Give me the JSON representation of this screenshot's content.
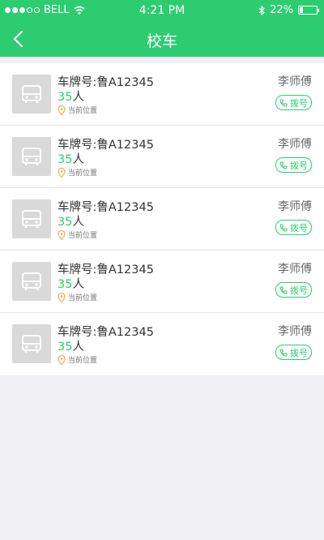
{
  "status_bar": {
    "carrier": "BELL",
    "time": "4:21 PM",
    "battery": "22%",
    "battery_level": 0.22
  },
  "header": {
    "title": "校车",
    "back_icon": "chevron-left-icon"
  },
  "buses": [
    {
      "plate": "车牌号:鲁A12345",
      "count": "35",
      "unit": "人",
      "location": "当前位置",
      "driver": "李师傅",
      "dial": "拨号"
    },
    {
      "plate": "车牌号:鲁A12345",
      "count": "35",
      "unit": "人",
      "location": "当前位置",
      "driver": "李师傅",
      "dial": "拨号"
    },
    {
      "plate": "车牌号:鲁A12345",
      "count": "35",
      "unit": "人",
      "location": "当前位置",
      "driver": "李师傅",
      "dial": "拨号"
    },
    {
      "plate": "车牌号:鲁A12345",
      "count": "35",
      "unit": "人",
      "location": "当前位置",
      "driver": "李师傅",
      "dial": "拨号"
    },
    {
      "plate": "车牌号:鲁A12345",
      "count": "35",
      "unit": "人",
      "location": "当前位置",
      "driver": "李师傅",
      "dial": "拨号"
    }
  ],
  "colors": {
    "brand": "#2ecc71",
    "background": "#efeff4",
    "pin": "#f0b45a"
  }
}
